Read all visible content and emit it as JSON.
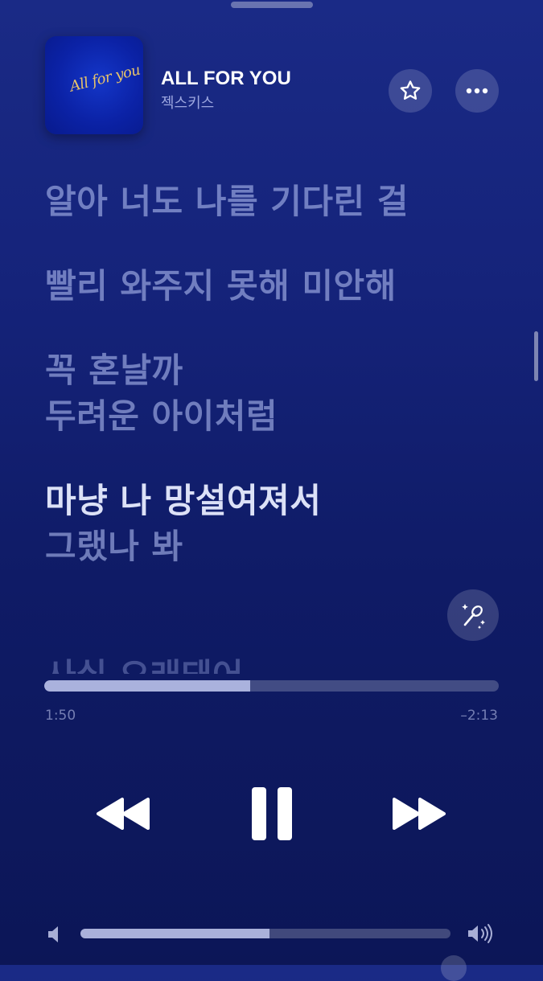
{
  "now_playing": {
    "title": "ALL FOR YOU",
    "artist": "젝스키스",
    "art_text": "All for you",
    "art_color": "#0b22a6"
  },
  "buttons": {
    "favorite_icon": "star-icon",
    "more_icon": "ellipsis-icon",
    "karaoke_icon": "sparkle-microphone-icon"
  },
  "lyrics": [
    {
      "lines": [
        "알아 너도 나를 기다린 걸"
      ],
      "active": false
    },
    {
      "lines": [
        "빨리 와주지 못해 미안해"
      ],
      "active": false
    },
    {
      "lines": [
        "꼭 혼날까",
        "두려운 아이처럼"
      ],
      "active": false
    },
    {
      "lines": [
        "마냥 나 망설여져서",
        "그랬나 봐"
      ],
      "active": true
    }
  ],
  "next_lyric_partial": "사실 오래돼어",
  "playback": {
    "elapsed": "1:50",
    "remaining": "–2:13",
    "progress_fraction": 0.453
  },
  "controls": {
    "rewind_icon": "rewind-icon",
    "pause_icon": "pause-icon",
    "forward_icon": "fast-forward-icon"
  },
  "volume": {
    "level_fraction": 0.51,
    "low_icon": "speaker-low-icon",
    "high_icon": "speaker-high-icon"
  },
  "colors": {
    "background_top": "#1a2a86",
    "background_bottom": "#0c1657",
    "accent": "#d2daff"
  }
}
